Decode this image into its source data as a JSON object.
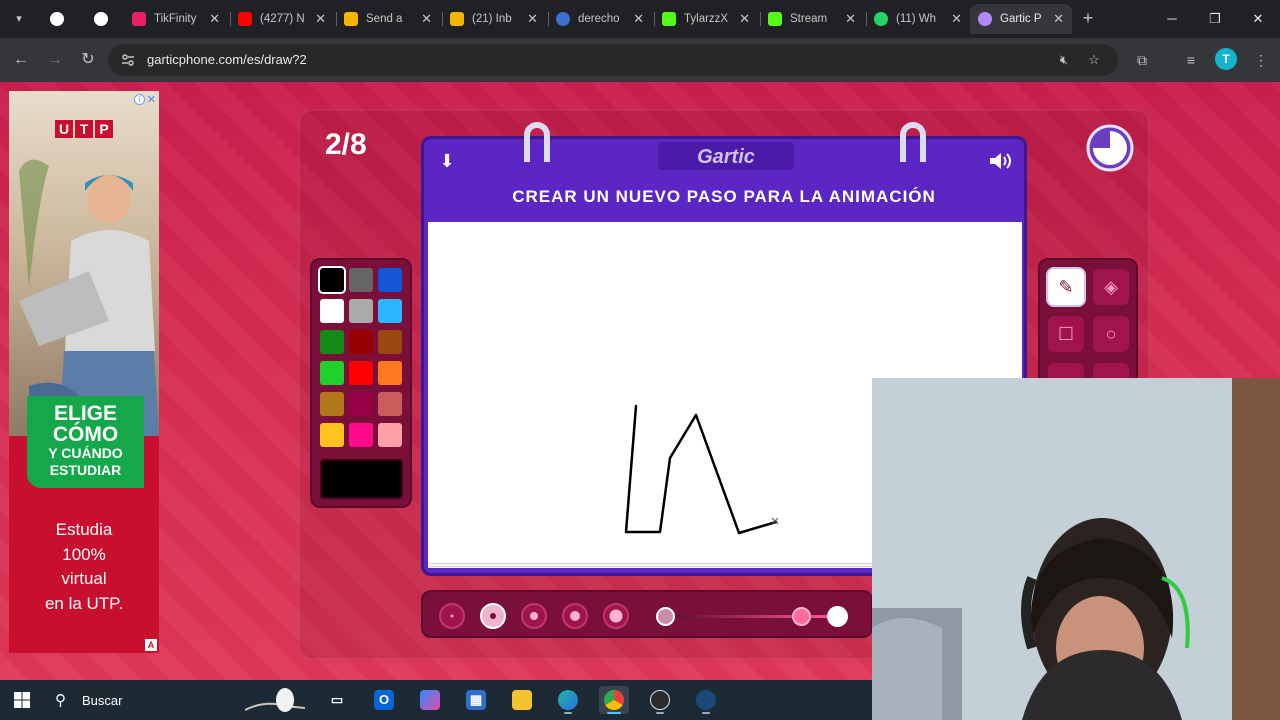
{
  "browser": {
    "tabs": [
      {
        "title": "TikFinity",
        "favicon_color": "#e91e63",
        "favicon": "tikfinity-icon"
      },
      {
        "title": "(4277) N",
        "favicon_color": "#ff0000",
        "favicon": "youtube-icon"
      },
      {
        "title": "Send a",
        "favicon_color": "#f4b400",
        "favicon": "send-icon"
      },
      {
        "title": "(21) Inb",
        "favicon_color": "#f4b400",
        "favicon": "inbox-icon"
      },
      {
        "title": "derecho",
        "favicon_color": "#3b6fd4",
        "favicon": "wordpress-icon"
      },
      {
        "title": "TylarzzX",
        "favicon_color": "#53fc18",
        "favicon": "kick-icon"
      },
      {
        "title": "Stream",
        "favicon_color": "#53fc18",
        "favicon": "kick-icon"
      },
      {
        "title": "(11) Wh",
        "favicon_color": "#25d366",
        "favicon": "whatsapp-icon"
      },
      {
        "title": "Gartic P",
        "favicon_color": "#b388ff",
        "favicon": "gartic-icon"
      }
    ],
    "url": "garticphone.com/es/draw?2"
  },
  "ad": {
    "brand": [
      "U",
      "T",
      "P"
    ],
    "headline": [
      "ELIGE",
      "CÓMO",
      "Y CUÁNDO",
      "ESTUDIAR"
    ],
    "body": [
      "Estudia",
      "100%",
      "virtual",
      "en la UTP."
    ],
    "badge": "A"
  },
  "game": {
    "round": "2/8",
    "logo": "Gartic",
    "instruction": "CREAR UN NUEVO PASO PARA LA ANIMACIÓN",
    "colors": [
      "#000000",
      "#666666",
      "#1556d6",
      "#ffffff",
      "#aaaaaa",
      "#2bb7ff",
      "#138a18",
      "#990000",
      "#99480f",
      "#1ed22b",
      "#ff0000",
      "#ff7a1f",
      "#b07818",
      "#990045",
      "#cc5b5b",
      "#ffc21f",
      "#ff0a89",
      "#ff9fa8"
    ],
    "selected_color": "#000000",
    "tools": [
      "pencil-icon",
      "eraser-icon",
      "rectangle-icon",
      "ellipse-icon"
    ],
    "brush_sizes": 5,
    "selected_brush_index": 1,
    "opacity": 0.8
  },
  "taskbar": {
    "search": "Buscar"
  }
}
